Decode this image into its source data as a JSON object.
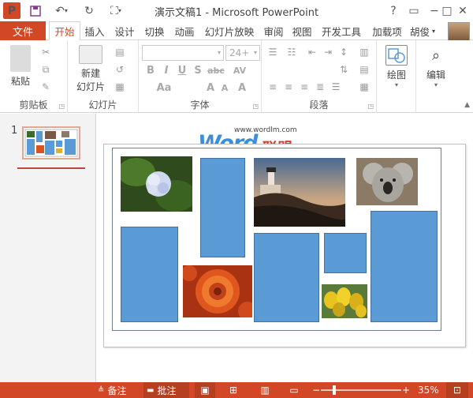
{
  "titlebar": {
    "app_logo": "P",
    "title": "演示文稿1 - Microsoft PowerPoint",
    "help": "?",
    "minimize": "−",
    "maximize": "□",
    "close": "✕"
  },
  "tabs": {
    "file": "文件",
    "items": [
      "开始",
      "插入",
      "设计",
      "切换",
      "动画",
      "幻灯片放映",
      "审阅",
      "视图",
      "开发工具",
      "加载项"
    ],
    "active": "开始",
    "user": "胡俊"
  },
  "ribbon": {
    "clipboard": {
      "paste": "粘贴",
      "label": "剪贴板"
    },
    "slides": {
      "new_slide_line1": "新建",
      "new_slide_line2": "幻灯片",
      "label": "幻灯片"
    },
    "font": {
      "size": "24+",
      "bold": "B",
      "italic": "I",
      "underline": "U",
      "shadow": "S",
      "strike": "abc",
      "spacing": "AV",
      "case": "Aa",
      "grow": "A",
      "shrink": "A",
      "clear": "A",
      "label": "字体"
    },
    "paragraph": {
      "label": "段落"
    },
    "drawing": {
      "label": "绘图"
    },
    "editing": {
      "label": "编辑"
    }
  },
  "thumbnails": {
    "slide_number": "1"
  },
  "watermark": {
    "url": "www.wordlm.com",
    "word": "Word",
    "cn": "联盟"
  },
  "statusbar": {
    "notes": "备注",
    "comments": "批注",
    "zoom_minus": "−",
    "zoom_plus": "+",
    "zoom": "35%"
  },
  "colors": {
    "accent": "#d24726",
    "placeholder_fill": "#5b9bd5",
    "placeholder_border": "#41719c"
  }
}
